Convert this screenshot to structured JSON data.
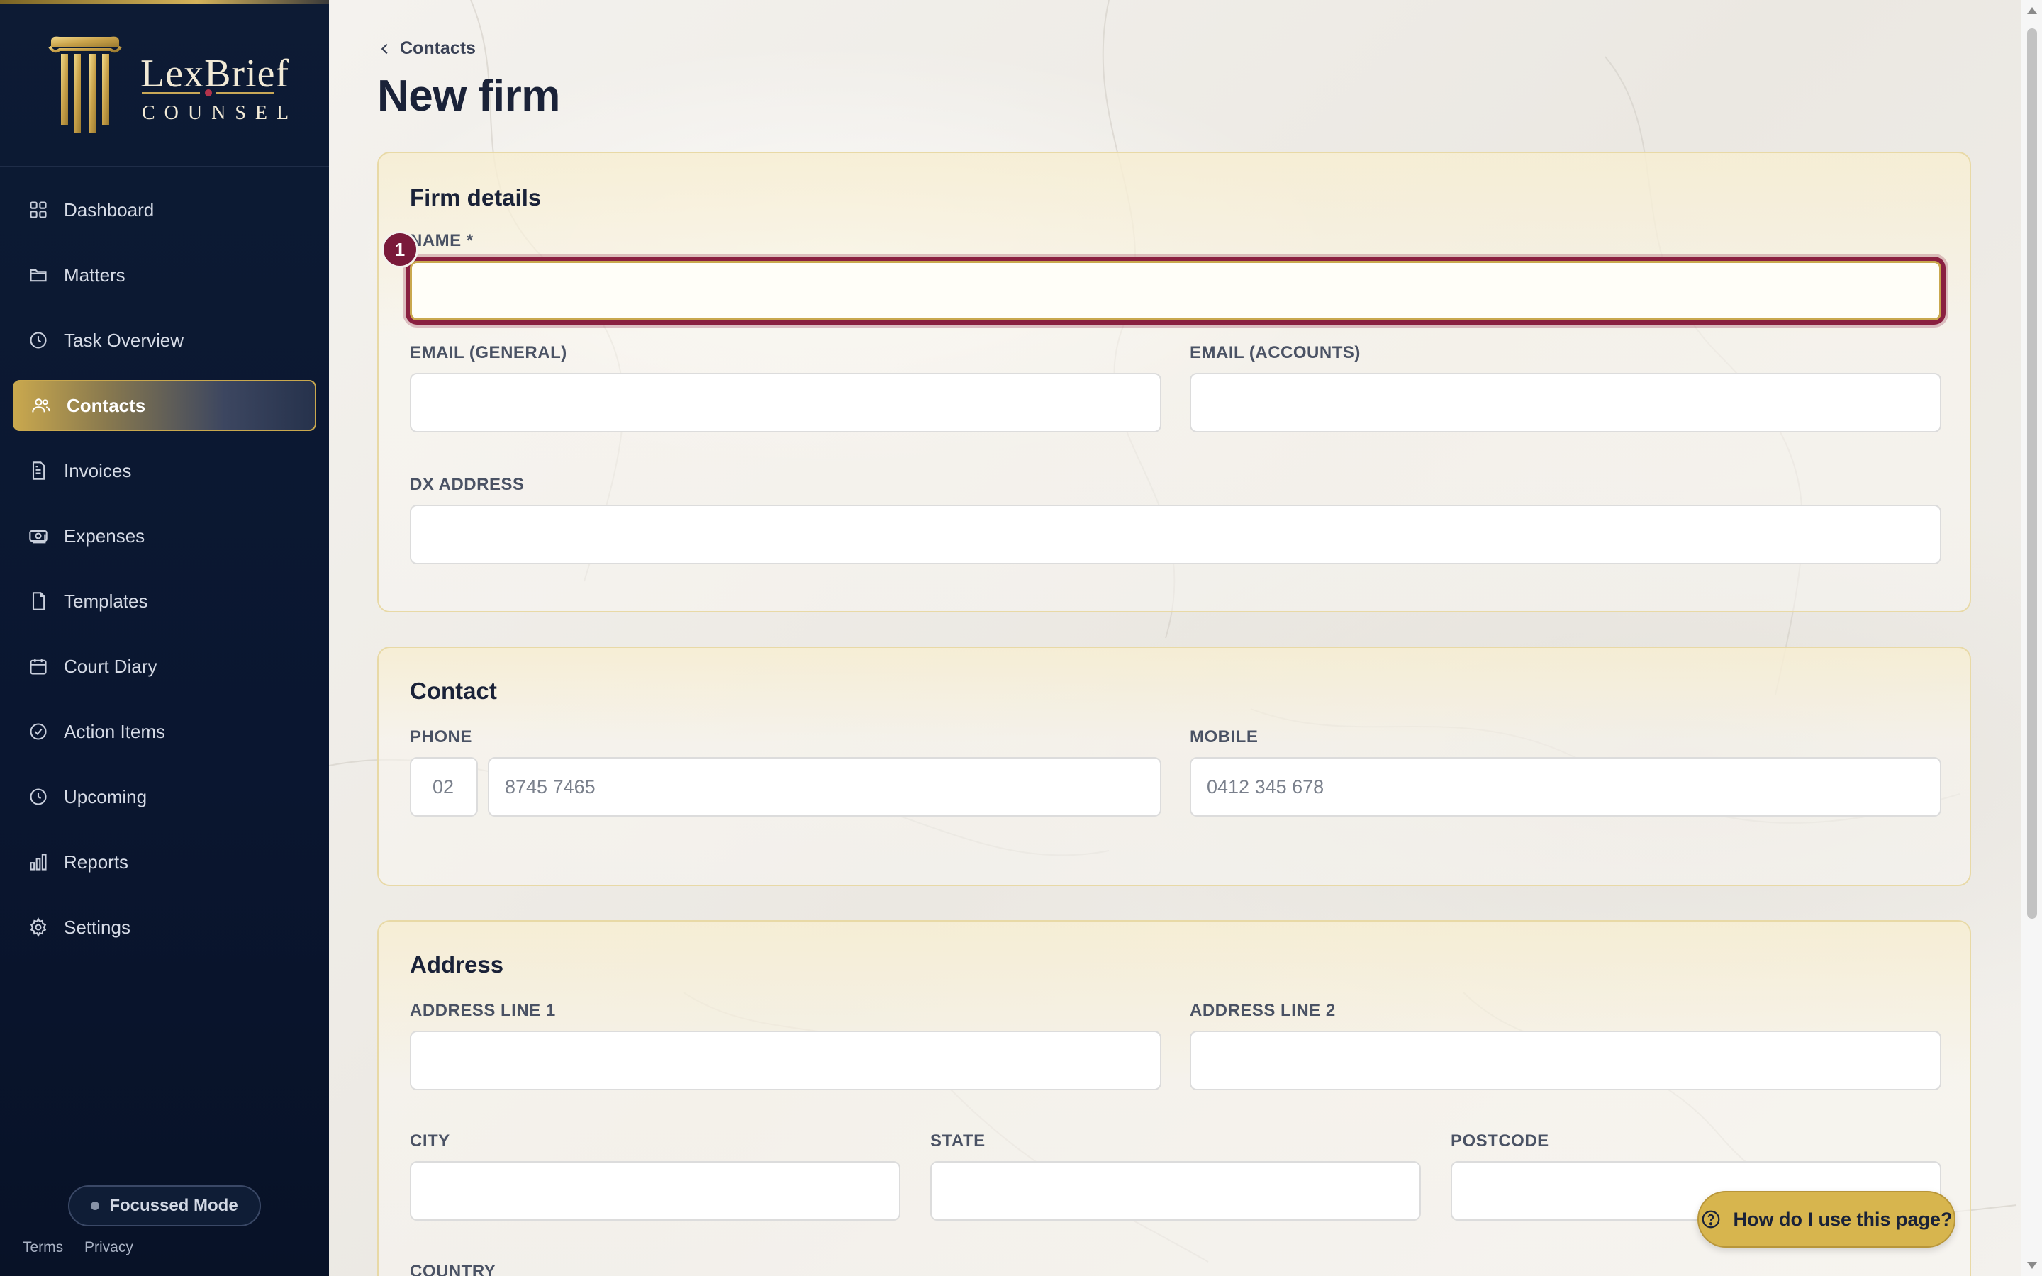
{
  "brand": {
    "name": "LexBrief",
    "tagline": "COUNSEL"
  },
  "sidebar": {
    "items": [
      {
        "label": "Dashboard",
        "icon": "dashboard-grid-icon"
      },
      {
        "label": "Matters",
        "icon": "folder-icon"
      },
      {
        "label": "Task Overview",
        "icon": "clock-icon"
      },
      {
        "label": "Contacts",
        "icon": "users-icon",
        "active": true
      },
      {
        "label": "Invoices",
        "icon": "invoice-icon"
      },
      {
        "label": "Expenses",
        "icon": "banknote-icon"
      },
      {
        "label": "Templates",
        "icon": "document-icon"
      },
      {
        "label": "Court Diary",
        "icon": "calendar-icon"
      },
      {
        "label": "Action Items",
        "icon": "check-circle-icon"
      },
      {
        "label": "Upcoming",
        "icon": "clock-icon"
      },
      {
        "label": "Reports",
        "icon": "bar-chart-icon"
      },
      {
        "label": "Settings",
        "icon": "gear-icon"
      }
    ],
    "focus_mode_label": "Focussed Mode",
    "footer_links": [
      "Terms",
      "Privacy"
    ]
  },
  "breadcrumb": {
    "back_label": "Contacts"
  },
  "page": {
    "title": "New firm"
  },
  "sections": {
    "firm_details": {
      "title": "Firm details",
      "name_label": "NAME *",
      "name_value": "",
      "email_general_label": "EMAIL (GENERAL)",
      "email_accounts_label": "EMAIL (ACCOUNTS)",
      "dx_address_label": "DX ADDRESS",
      "step_badge": "1"
    },
    "contact": {
      "title": "Contact",
      "phone_label": "PHONE",
      "phone_area_placeholder": "02",
      "phone_placeholder": "8745 7465",
      "mobile_label": "MOBILE",
      "mobile_placeholder": "0412 345 678"
    },
    "address": {
      "title": "Address",
      "line1_label": "ADDRESS LINE 1",
      "line2_label": "ADDRESS LINE 2",
      "city_label": "CITY",
      "state_label": "STATE",
      "postcode_label": "POSTCODE",
      "country_label": "COUNTRY"
    }
  },
  "help": {
    "label": "How do I use this page?"
  },
  "colors": {
    "sidebar_bg": "#0d1b34",
    "accent_gold": "#c9a84e",
    "focus_ring": "#8a2040",
    "heading": "#1a2238"
  }
}
